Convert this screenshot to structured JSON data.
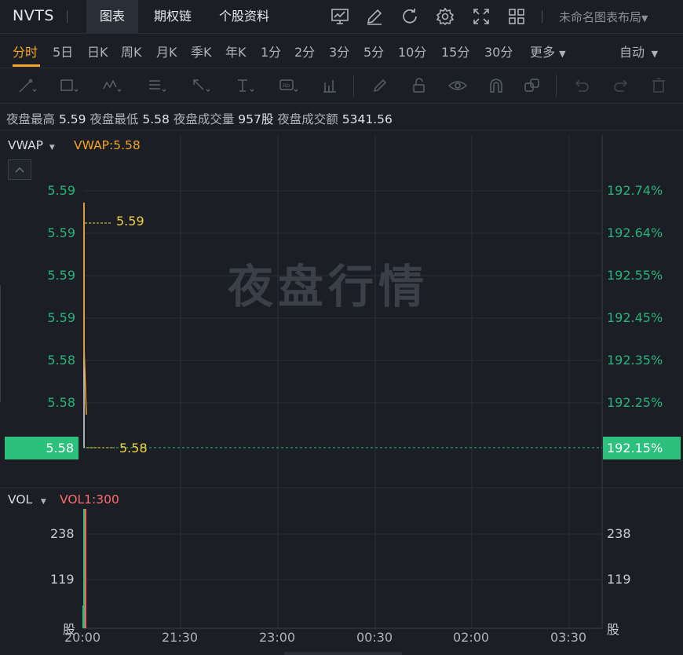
{
  "header": {
    "ticker": "NVTS",
    "tabs": [
      {
        "label": "图表",
        "active": true
      },
      {
        "label": "期权链",
        "active": false
      },
      {
        "label": "个股资料",
        "active": false
      }
    ],
    "icons": [
      "chart-draw-icon",
      "pen-icon",
      "refresh-icon",
      "settings-icon",
      "fullscreen-icon",
      "grid-layout-icon"
    ],
    "layout_name": "未命名图表布局"
  },
  "periods": {
    "items": [
      "分时",
      "5日",
      "日K",
      "周K",
      "月K",
      "季K",
      "年K",
      "1分",
      "2分",
      "3分",
      "5分",
      "10分",
      "15分",
      "30分",
      "更多"
    ],
    "active": "分时",
    "auto_label": "自动"
  },
  "stats": {
    "high_label": "夜盘最高",
    "high": "5.59",
    "low_label": "夜盘最低",
    "low": "5.58",
    "vol_label": "夜盘成交量",
    "vol": "957股",
    "amt_label": "夜盘成交额",
    "amt": "5341.56"
  },
  "main_panel": {
    "indicator": "VWAP",
    "indicator_value": "VWAP:5.58",
    "watermark": "夜盘行情",
    "left_ticks": [
      "5.59",
      "5.59",
      "5.59",
      "5.59",
      "5.58",
      "5.58"
    ],
    "right_ticks": [
      "192.74%",
      "192.64%",
      "192.55%",
      "192.45%",
      "192.35%",
      "192.25%"
    ],
    "current_price": "5.58",
    "current_pct": "192.15%",
    "high_marker": "5.59",
    "low_marker": "5.58"
  },
  "vol_panel": {
    "indicator": "VOL",
    "indicator_value": "VOL1:300",
    "left_ticks": [
      "238",
      "119",
      "股"
    ],
    "right_ticks": [
      "238",
      "119",
      "股"
    ]
  },
  "x_ticks": [
    "20:00",
    "21:30",
    "23:00",
    "00:30",
    "02:00",
    "03:30"
  ],
  "colors": {
    "up": "#2bc17c",
    "price_line": "#f5a623",
    "vwap": "#f5a623",
    "vol_label": "#ff6b6b",
    "marker": "#f0d040"
  },
  "chart_data": {
    "type": "line",
    "series": [
      {
        "name": "VWAP",
        "values": [
          5.59,
          5.585
        ]
      },
      {
        "name": "VOL1",
        "values": [
          300
        ]
      }
    ],
    "x": [
      "20:00",
      "20:01"
    ]
  }
}
